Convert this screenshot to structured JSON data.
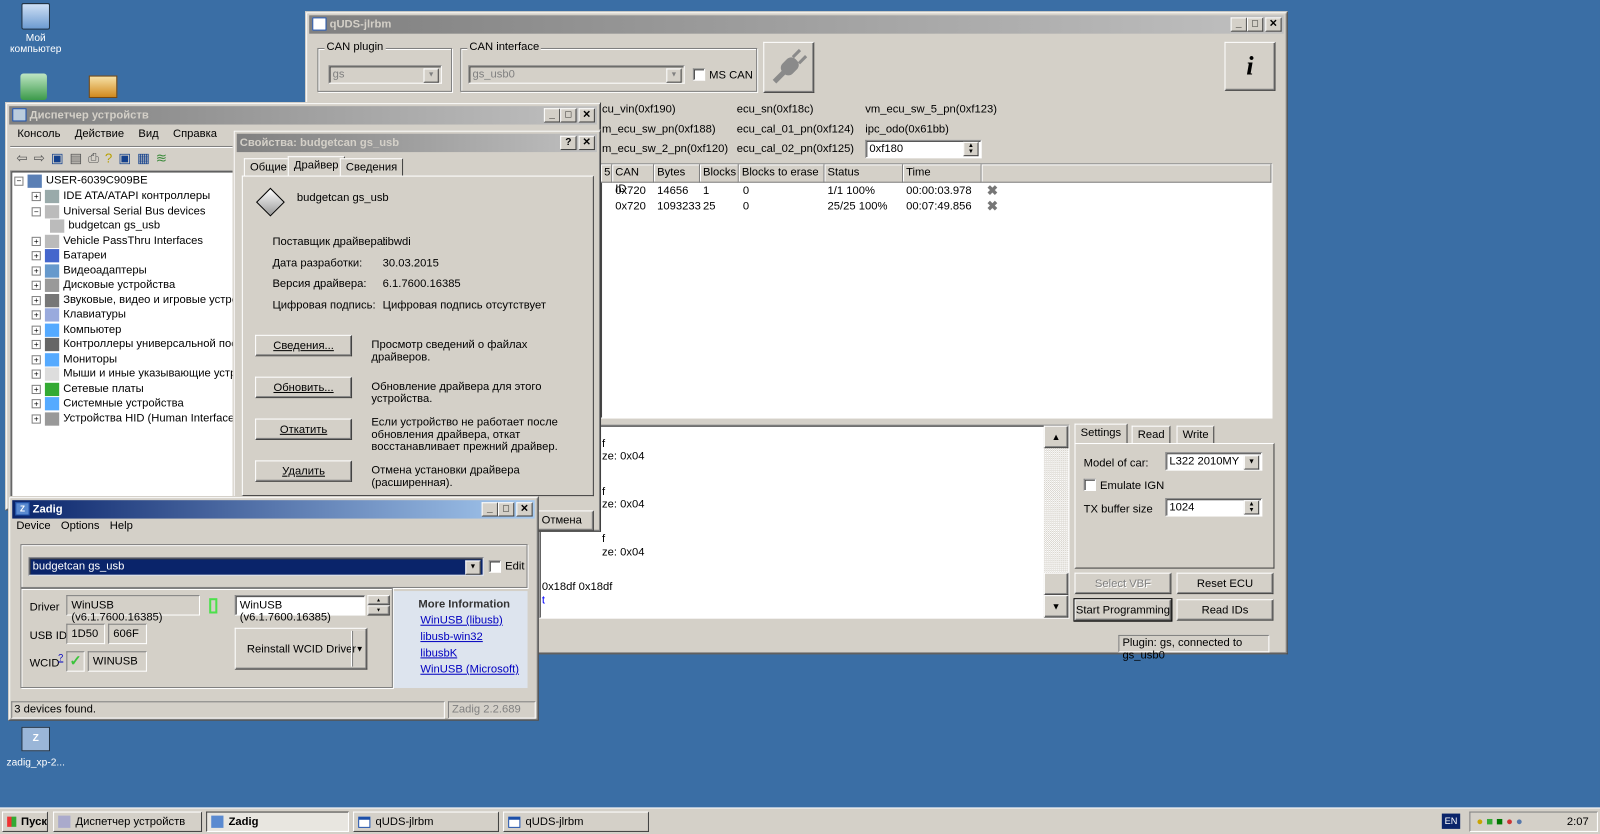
{
  "desktop": {
    "icons": [
      {
        "label": "Мой компьютер"
      },
      {
        "label": "zadig_xp-2..."
      }
    ]
  },
  "quds": {
    "title": "qUDS-jlrbm",
    "can_plugin": {
      "label": "CAN plugin",
      "value": "gs"
    },
    "can_interface": {
      "label": "CAN interface",
      "value": "gs_usb0",
      "ms_can_label": "MS CAN",
      "ms_can_checked": false
    },
    "info_label": "i",
    "ids": [
      [
        "cu_vin(0xf190)",
        "ecu_sn(0xf18c)",
        "vm_ecu_sw_5_pn(0xf123)"
      ],
      [
        "m_ecu_sw_pn(0xf188)",
        "ecu_cal_01_pn(0xf124)",
        "ipc_odo(0x61bb)"
      ],
      [
        "m_ecu_sw_2_pn(0xf120)",
        "ecu_cal_02_pn(0xf125)"
      ]
    ],
    "did_input": "0xf180",
    "table": {
      "headers": [
        "5",
        "CAN ID",
        "Bytes",
        "Blocks",
        "Blocks to erase",
        "Status",
        "Time"
      ],
      "rows": [
        [
          "",
          "0x720",
          "14656",
          "1",
          "0",
          "1/1 100%",
          "00:00:03.978"
        ],
        [
          "",
          "0x720",
          "1093233",
          "25",
          "0",
          "25/25 100%",
          "00:07:49.856"
        ]
      ]
    },
    "log": [
      "f",
      "ze: 0x04",
      "f",
      "ze: 0x04",
      "f",
      "ze: 0x04",
      "0x18df 0x18df",
      "t"
    ],
    "tabs": [
      "Settings",
      "Read",
      "Write"
    ],
    "settings": {
      "model_label": "Model of car:",
      "model_value": "L322 2010MY",
      "emulate_label": "Emulate IGN",
      "emulate_checked": false,
      "tx_label": "TX buffer size",
      "tx_value": "1024"
    },
    "buttons": {
      "select_vbf": "Select VBF",
      "reset_ecu": "Reset ECU",
      "start_programming": "Start Programming",
      "read_ids": "Read IDs"
    },
    "status": "Plugin: gs, connected to gs_usb0"
  },
  "devmgr": {
    "title": "Диспетчер устройств",
    "menu": [
      "Консоль",
      "Действие",
      "Вид",
      "Справка"
    ],
    "root": "USER-6039C909BE",
    "items": [
      "IDE ATA/ATAPI контроллеры",
      "Universal Serial Bus devices",
      "budgetcan gs_usb",
      "Vehicle PassThru Interfaces",
      "Батареи",
      "Видеоадаптеры",
      "Дисковые устройства",
      "Звуковые, видео и игровые устройства",
      "Клавиатуры",
      "Компьютер",
      "Контроллеры универсальной последовательной шины",
      "Мониторы",
      "Мыши и иные указывающие устройства",
      "Сетевые платы",
      "Системные устройства",
      "Устройства HID (Human Interface Devices)"
    ]
  },
  "props": {
    "title": "Свойства: budgetcan gs_usb",
    "help": "?",
    "tabs": [
      "Общие",
      "Драйвер",
      "Сведения"
    ],
    "device_name": "budgetcan gs_usb",
    "fields": [
      {
        "label": "Поставщик драйвера:",
        "value": "libwdi"
      },
      {
        "label": "Дата разработки:",
        "value": "30.03.2015"
      },
      {
        "label": "Версия драйвера:",
        "value": "6.1.7600.16385"
      },
      {
        "label": "Цифровая подпись:",
        "value": "Цифровая подпись отсутствует"
      }
    ],
    "actions": [
      {
        "button": "Сведения...",
        "desc": "Просмотр сведений о файлах драйверов."
      },
      {
        "button": "Обновить...",
        "desc": "Обновление драйвера для этого устройства."
      },
      {
        "button": "Откатить",
        "desc": "Если устройство не работает после обновления драйвера, откат восстанавливает прежний драйвер."
      },
      {
        "button": "Удалить",
        "desc": "Отмена установки драйвера (расширенная)."
      }
    ],
    "cancel": "Отмена"
  },
  "zadig": {
    "title": "Zadig",
    "menu": [
      "Device",
      "Options",
      "Help"
    ],
    "device": "budgetcan gs_usb",
    "edit_label": "Edit",
    "driver_label": "Driver",
    "driver_current": "WinUSB (v6.1.7600.16385)",
    "driver_target": "WinUSB (v6.1.7600.16385)",
    "usbid_label": "USB ID",
    "vid": "1D50",
    "pid": "606F",
    "wcid_label": "WCID",
    "wcid_help": "?",
    "wcid_value": "WINUSB",
    "install_button": "Reinstall WCID Driver",
    "more_info": "More Information",
    "links": [
      "WinUSB (libusb)",
      "libusb-win32",
      "libusbK",
      "WinUSB (Microsoft)"
    ],
    "status": "3 devices found.",
    "version": "Zadig 2.2.689"
  },
  "taskbar": {
    "start": "Пуск",
    "tasks": [
      "Диспетчер устройств",
      "Zadig",
      "qUDS-jlrbm",
      "qUDS-jlrbm"
    ],
    "lang": "EN",
    "clock": "2:07"
  }
}
